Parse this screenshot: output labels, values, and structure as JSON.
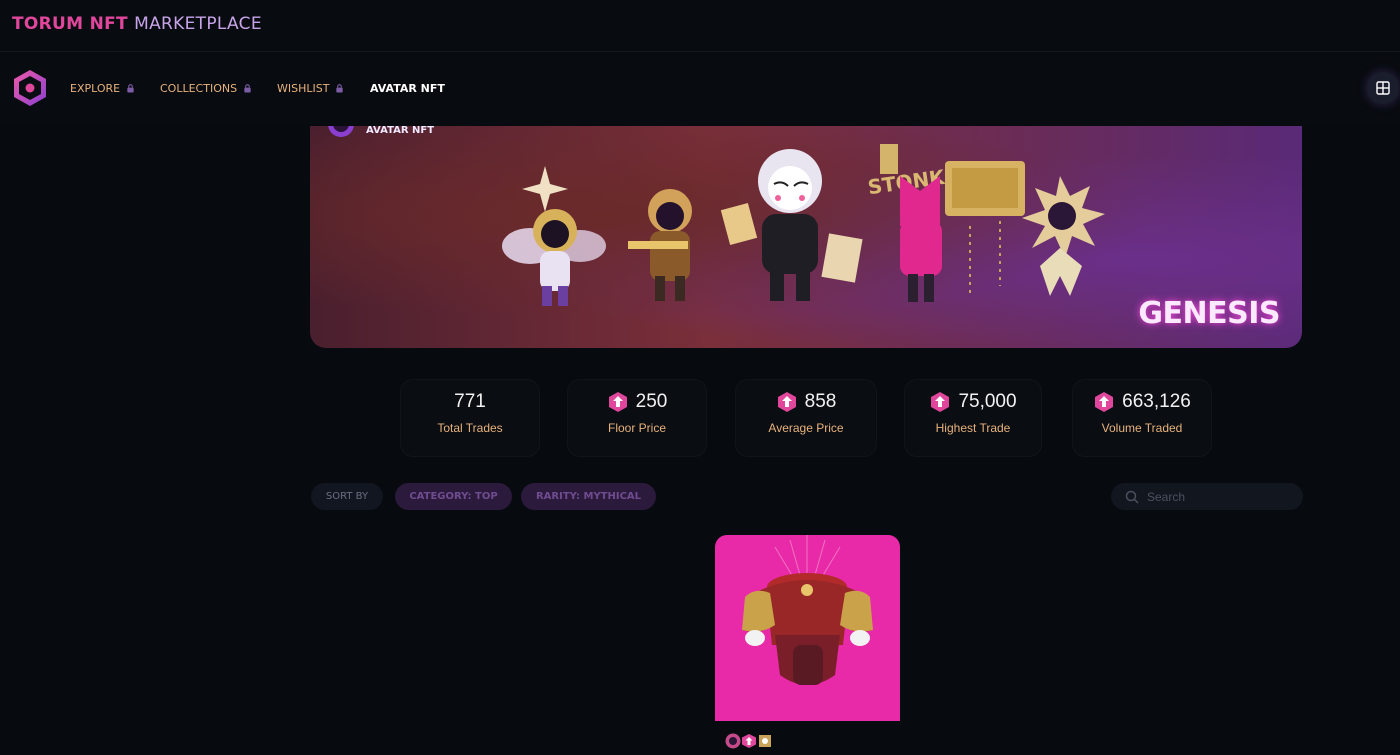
{
  "app": {
    "brand_part1": "TORUM NFT",
    "brand_part2": "MARKETPLACE"
  },
  "nav": {
    "items": [
      {
        "label": "EXPLORE",
        "locked": true
      },
      {
        "label": "COLLECTIONS",
        "locked": true
      },
      {
        "label": "WISHLIST",
        "locked": true
      },
      {
        "label": "AVATAR NFT",
        "locked": false,
        "active": true
      }
    ]
  },
  "banner": {
    "title": "AVATAR NFT",
    "wordmark": "GENESIS",
    "sign_text": "STONKS"
  },
  "stats": [
    {
      "value": "771",
      "label": "Total Trades",
      "token_icon": false
    },
    {
      "value": "250",
      "label": "Floor Price",
      "token_icon": true
    },
    {
      "value": "858",
      "label": "Average Price",
      "token_icon": true
    },
    {
      "value": "75,000",
      "label": "Highest Trade",
      "token_icon": true
    },
    {
      "value": "663,126",
      "label": "Volume Traded",
      "token_icon": true
    }
  ],
  "filters": {
    "sort_label": "SORT BY",
    "category": "CATEGORY: TOP",
    "rarity": "RARITY: MYTHICAL",
    "search_placeholder": "Search"
  },
  "colors": {
    "accent_pink": "#e0479c",
    "label_orange": "#e8b27c",
    "card_bg": "#e82aa8",
    "background": "#070b10"
  }
}
